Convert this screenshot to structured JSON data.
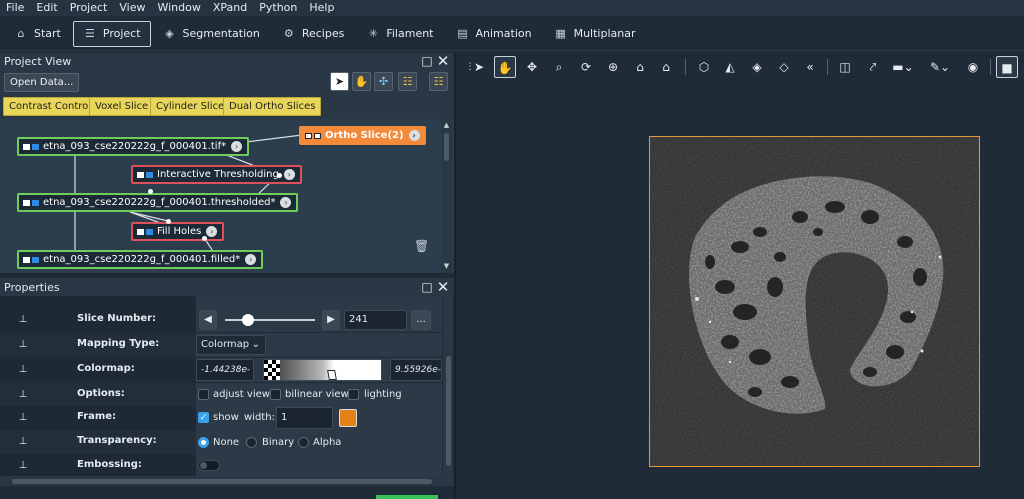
{
  "menu": [
    "File",
    "Edit",
    "Project",
    "View",
    "Window",
    "XPand",
    "Python",
    "Help"
  ],
  "workrooms": [
    {
      "label": "Start",
      "icon": "home-icon",
      "active": false
    },
    {
      "label": "Project",
      "icon": "project-icon",
      "active": true
    },
    {
      "label": "Segmentation",
      "icon": "layers-icon",
      "active": false
    },
    {
      "label": "Recipes",
      "icon": "recipes-icon",
      "active": false
    },
    {
      "label": "Filament",
      "icon": "filament-icon",
      "active": false
    },
    {
      "label": "Animation",
      "icon": "film-icon",
      "active": false
    },
    {
      "label": "Multiplanar",
      "icon": "multiplanar-icon",
      "active": false
    }
  ],
  "project_view": {
    "title": "Project View",
    "open_data_label": "Open Data...",
    "quick_buttons": [
      "Contrast Control",
      "Voxel Slice",
      "Cylinder Slice",
      "Dual Ortho Slices"
    ],
    "nodes": {
      "tif": "etna_093_cse220222g_f_000401.tif*",
      "ortho": "Ortho Slice(2)",
      "threshold": "Interactive Thresholding",
      "thresholded": "etna_093_cse220222g_f_000401.thresholded*",
      "fillholes": "Fill Holes",
      "filled": "etna_093_cse220222g_f_000401.filled*"
    }
  },
  "properties": {
    "title": "Properties",
    "slice_number": {
      "label": "Slice Number:",
      "value": "241",
      "more": "...",
      "slider_fraction": 0.25
    },
    "mapping_type": {
      "label": "Mapping Type:",
      "value": "Colormap"
    },
    "colormap": {
      "label": "Colormap:",
      "min": "-1.44238e-4",
      "max": "9.55926e-4"
    },
    "options": {
      "label": "Options:",
      "items": [
        "adjust view",
        "bilinear view",
        "lighting"
      ]
    },
    "frame": {
      "label": "Frame:",
      "show": "show",
      "width_label": "width:",
      "width_value": "1",
      "color": "#e8801a"
    },
    "transparency": {
      "label": "Transparency:",
      "choices": [
        "None",
        "Binary",
        "Alpha"
      ],
      "selected": "None"
    },
    "embossing": {
      "label": "Embossing:",
      "on": false
    }
  },
  "viewer": {
    "frame_color": "#e9963b"
  },
  "colors": {
    "accent": "#3aa0ea",
    "data_node": "#6fce5a",
    "proc_node": "#e0505a",
    "display_node": "#f28a3a",
    "quick_button": "#e8d65a"
  }
}
